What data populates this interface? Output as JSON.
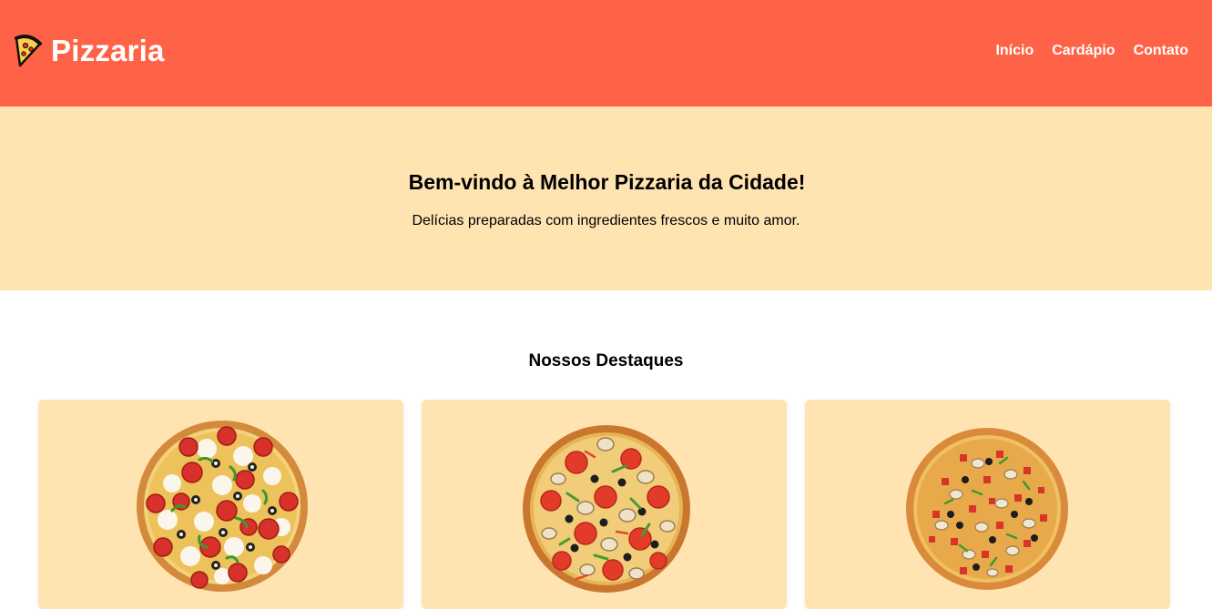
{
  "header": {
    "brand_icon": "pizza-slice-icon",
    "brand_title": "Pizzaria",
    "nav": [
      {
        "label": "Início"
      },
      {
        "label": "Cardápio"
      },
      {
        "label": "Contato"
      }
    ]
  },
  "hero": {
    "title": "Bem-vindo à Melhor Pizzaria da Cidade!",
    "subtitle": "Delícias preparadas com ingredientes frescos e muito amor."
  },
  "featured": {
    "title": "Nossos Destaques",
    "cards": [
      {
        "image": "pepperoni-pizza-image"
      },
      {
        "image": "tomato-mushroom-pizza-image"
      },
      {
        "image": "supreme-pizza-image"
      }
    ]
  },
  "colors": {
    "header_bg": "#ff6347",
    "hero_bg": "#ffe4b2",
    "card_bg": "#ffe4b2"
  }
}
